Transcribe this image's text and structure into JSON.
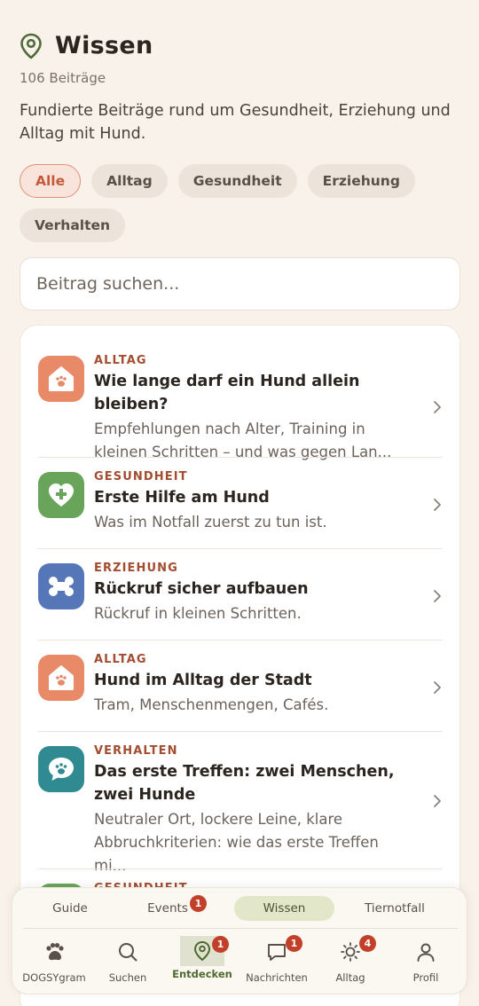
{
  "header": {
    "title": "Wissen",
    "count": "106 Beiträge",
    "intro": "Fundierte Beiträge rund um Gesundheit, Erziehung und Alltag mit Hund."
  },
  "filters": {
    "selected": "Alle",
    "items": [
      "Alle",
      "Alltag",
      "Gesundheit",
      "Erziehung",
      "Verhalten"
    ]
  },
  "search": {
    "placeholder": "Beitrag suchen..."
  },
  "articles": [
    {
      "category": "ALLTAG",
      "title": "Wie lange darf ein Hund allein bleiben?",
      "description": "Empfehlungen nach Alter, Training in kleinen Schritten – und was gegen Lan...",
      "icon": "house-paw-icon",
      "color": "#e88a68"
    },
    {
      "category": "GESUNDHEIT",
      "title": "Erste Hilfe am Hund",
      "description": "Was im Notfall zuerst zu tun ist.",
      "icon": "heart-plus-icon",
      "color": "#69a45b"
    },
    {
      "category": "ERZIEHUNG",
      "title": "Rückruf sicher aufbauen",
      "description": "Rückruf in kleinen Schritten.",
      "icon": "bone-icon",
      "color": "#5577b8"
    },
    {
      "category": "ALLTAG",
      "title": "Hund im Alltag der Stadt",
      "description": "Tram, Menschenmengen, Cafés.",
      "icon": "house-paw-icon",
      "color": "#e88a68"
    },
    {
      "category": "VERHALTEN",
      "title": "Das erste Treffen: zwei Menschen, zwei Hunde",
      "description": "Neutraler Ort, lockere Leine, klare Abbruchkriterien: wie das erste Treffen mi...",
      "icon": "chat-paw-icon",
      "color": "#2f8a92"
    },
    {
      "category": "GESUNDHEIT",
      "title": "",
      "description": "",
      "icon": "heart-plus-icon",
      "color": "#69a45b"
    }
  ],
  "top_nav": {
    "items": [
      {
        "label": "Guide",
        "badge": ""
      },
      {
        "label": "Events",
        "badge": "1"
      },
      {
        "label": "Wissen",
        "badge": ""
      },
      {
        "label": "Tiernotfall",
        "badge": ""
      }
    ],
    "active": "Wissen"
  },
  "bottom_nav": {
    "items": [
      {
        "label": "DOGSYgram",
        "icon": "paw-icon",
        "badge": ""
      },
      {
        "label": "Suchen",
        "icon": "search-icon",
        "badge": ""
      },
      {
        "label": "Entdecken",
        "icon": "map-pin-icon",
        "badge": "1"
      },
      {
        "label": "Nachrichten",
        "icon": "chat-icon",
        "badge": "1"
      },
      {
        "label": "Alltag",
        "icon": "sun-icon",
        "badge": "4"
      },
      {
        "label": "Profil",
        "icon": "user-icon",
        "badge": ""
      }
    ],
    "active": "Entdecken"
  },
  "colors": {
    "accent": "#c45a3c",
    "category": "#a24d30",
    "badge": "#c2402a",
    "active_green": "#4c6a2f"
  }
}
